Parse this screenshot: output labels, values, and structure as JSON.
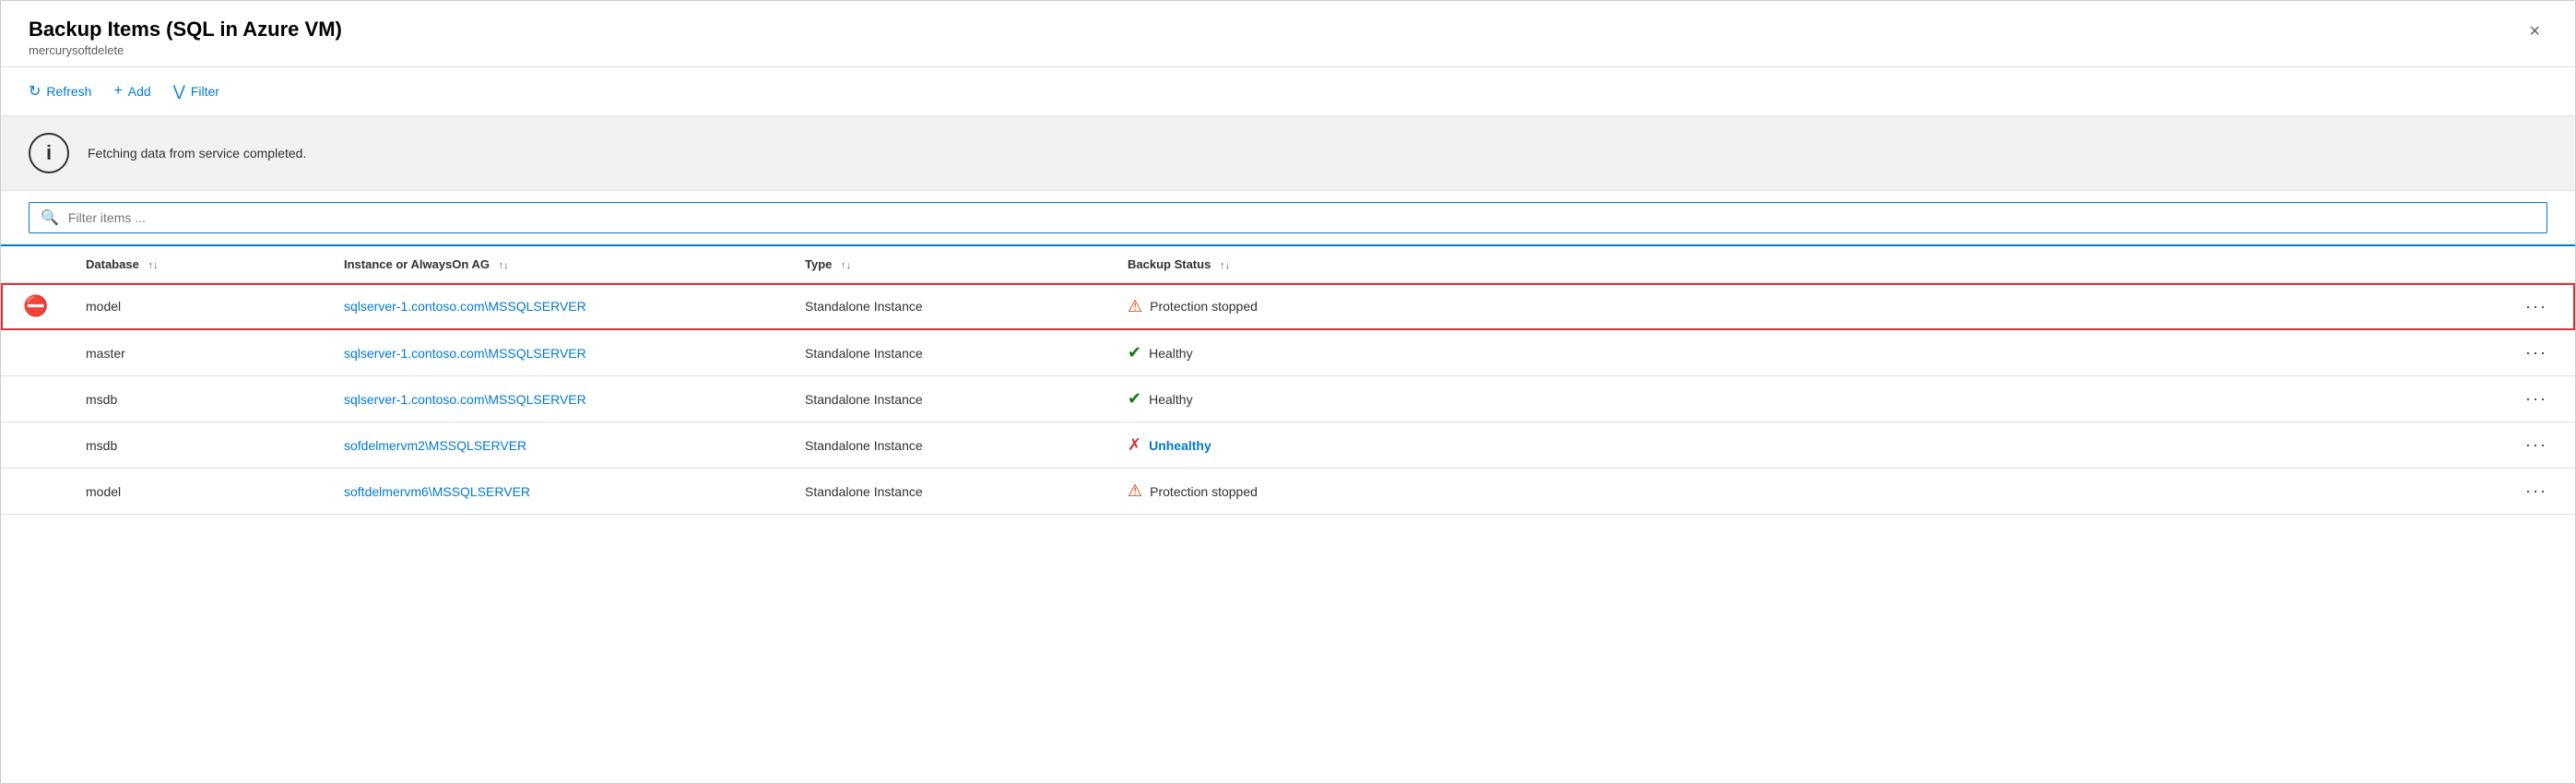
{
  "header": {
    "title": "Backup Items (SQL in Azure VM)",
    "subtitle": "mercurysoftdelete",
    "close_label": "×"
  },
  "toolbar": {
    "refresh_label": "Refresh",
    "add_label": "Add",
    "filter_label": "Filter"
  },
  "banner": {
    "message": "Fetching data from service completed."
  },
  "filter": {
    "placeholder": "Filter items ..."
  },
  "table": {
    "columns": [
      {
        "key": "database",
        "label": "Database"
      },
      {
        "key": "instance",
        "label": "Instance or AlwaysOn AG"
      },
      {
        "key": "type",
        "label": "Type"
      },
      {
        "key": "backup_status",
        "label": "Backup Status"
      }
    ],
    "rows": [
      {
        "id": 1,
        "selected": true,
        "icon": "stop",
        "database": "model",
        "instance": "sqlserver-1.contoso.com\\MSSQLSERVER",
        "type": "Standalone Instance",
        "backup_status": "Protection stopped",
        "status_type": "warning"
      },
      {
        "id": 2,
        "selected": false,
        "icon": "none",
        "database": "master",
        "instance": "sqlserver-1.contoso.com\\MSSQLSERVER",
        "type": "Standalone Instance",
        "backup_status": "Healthy",
        "status_type": "healthy"
      },
      {
        "id": 3,
        "selected": false,
        "icon": "none",
        "database": "msdb",
        "instance": "sqlserver-1.contoso.com\\MSSQLSERVER",
        "type": "Standalone Instance",
        "backup_status": "Healthy",
        "status_type": "healthy"
      },
      {
        "id": 4,
        "selected": false,
        "icon": "none",
        "database": "msdb",
        "instance": "sofdelmervm2\\MSSQLSERVER",
        "type": "Standalone Instance",
        "backup_status": "Unhealthy",
        "status_type": "unhealthy"
      },
      {
        "id": 5,
        "selected": false,
        "icon": "none",
        "database": "model",
        "instance": "softdelmervm6\\MSSQLSERVER",
        "type": "Standalone Instance",
        "backup_status": "Protection stopped",
        "status_type": "warning"
      }
    ]
  }
}
